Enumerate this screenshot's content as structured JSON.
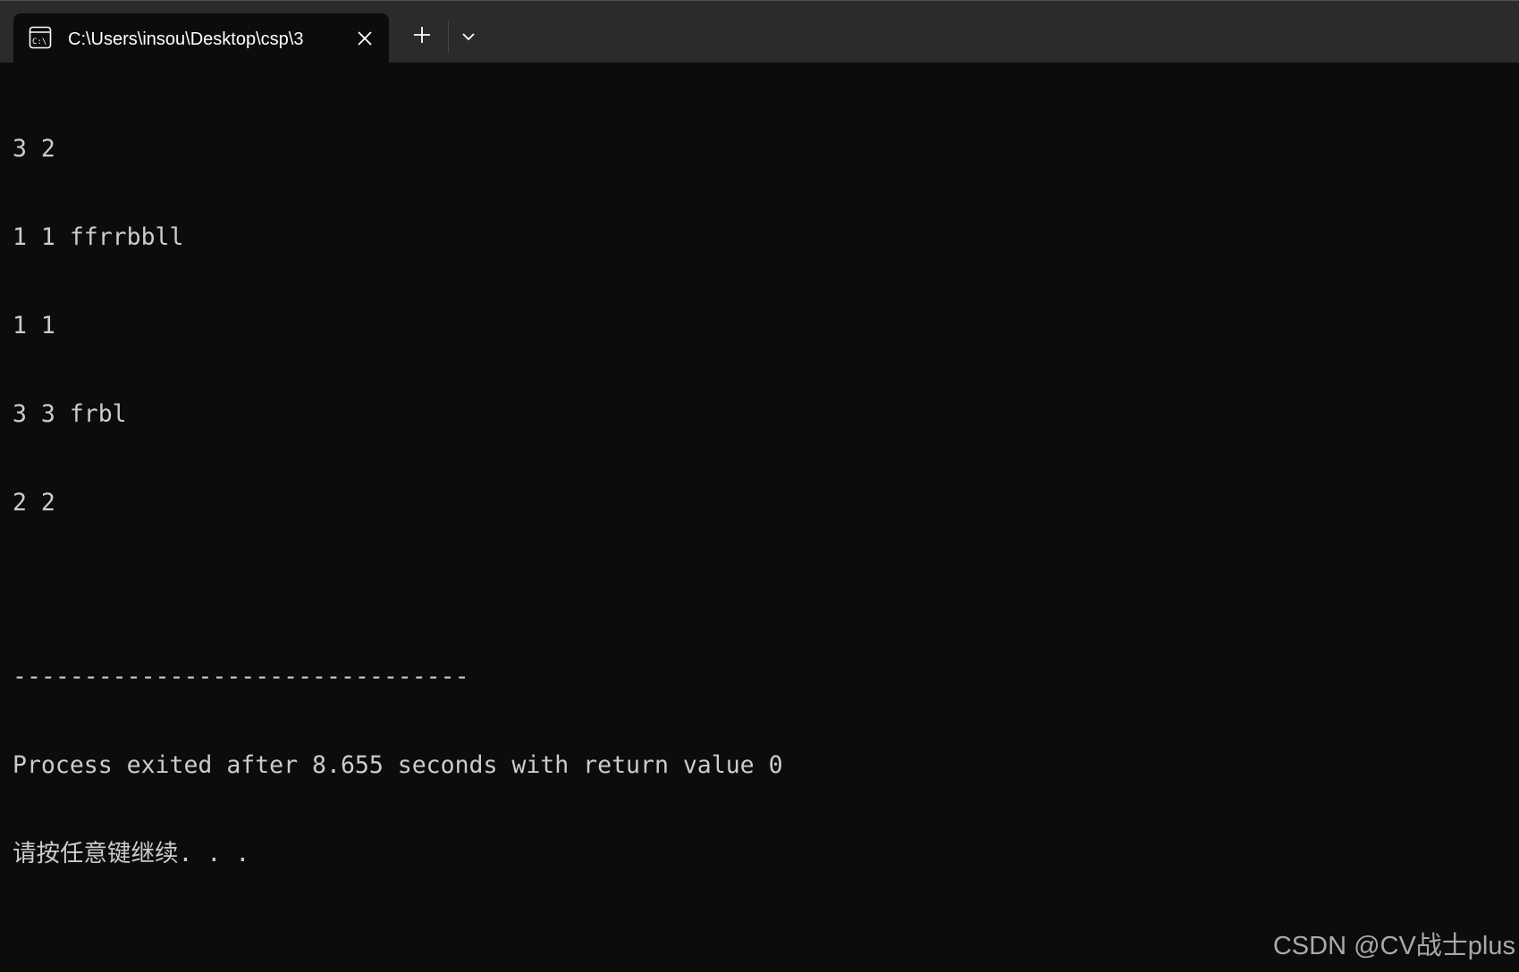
{
  "window": {
    "tab": {
      "title": "C:\\Users\\insou\\Desktop\\csp\\3",
      "icon": "console-icon",
      "close_icon": "close-icon"
    },
    "new_tab_icon": "plus-icon",
    "dropdown_icon": "chevron-down-icon"
  },
  "console": {
    "lines": [
      "3 2",
      "1 1 ffrrbbll",
      "1 1",
      "3 3 frbl",
      "2 2",
      "",
      "--------------------------------",
      "Process exited after 8.655 seconds with return value 0",
      "请按任意键继续. . ."
    ]
  },
  "watermark": "CSDN @CV战士plus",
  "colors": {
    "titlebar": "#2b2b2b",
    "background": "#0c0c0c",
    "text": "#cccccc"
  }
}
